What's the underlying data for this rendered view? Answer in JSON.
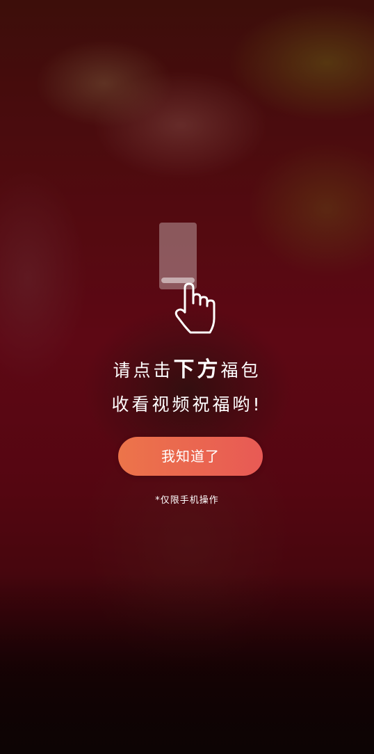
{
  "guide": {
    "line1_a": "请点击",
    "line1_emphasis": "下方",
    "line1_b": "福包",
    "line2": "收看视频祝福哟!",
    "button_label": "我知道了",
    "note": "*仅限手机操作"
  },
  "icons": {
    "hint": "phone-tap-hand-icon"
  },
  "colors": {
    "button_start": "#ec744a",
    "button_end": "#e85a55",
    "text": "#ffffff",
    "background": "#8a0c1e"
  }
}
